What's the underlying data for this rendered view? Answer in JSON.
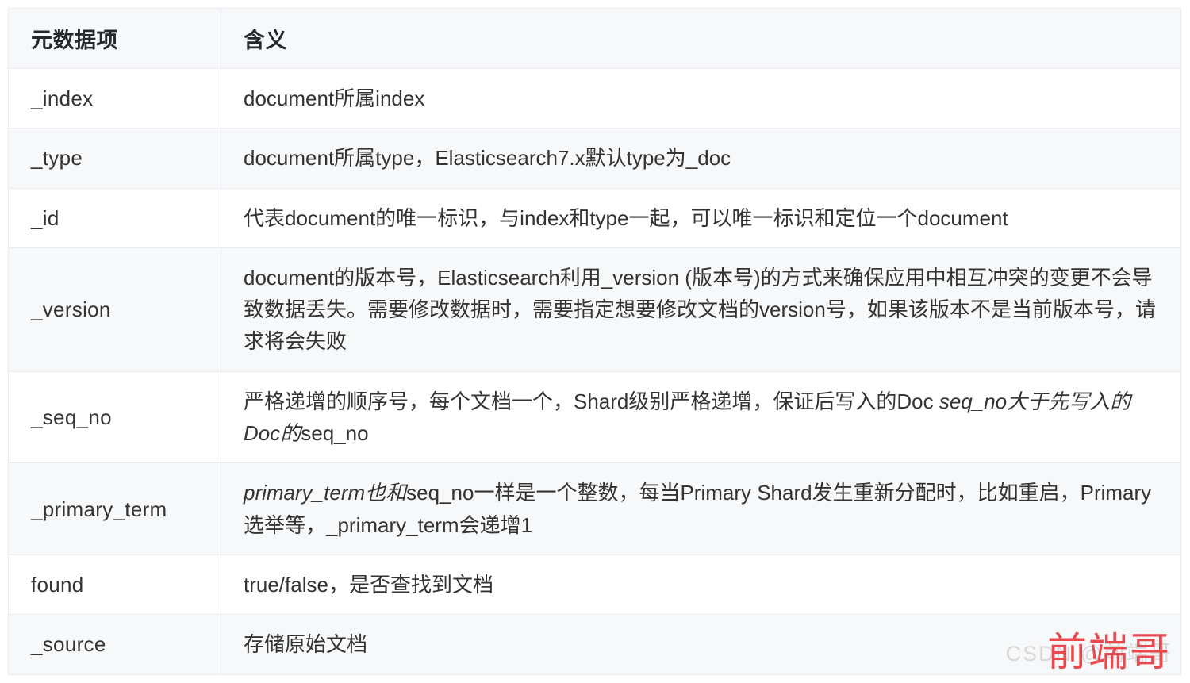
{
  "table": {
    "headers": [
      "元数据项",
      "含义"
    ],
    "rows": [
      {
        "key": "_index",
        "value_segments": [
          {
            "text": "document所属index",
            "italic": false
          }
        ]
      },
      {
        "key": "_type",
        "value_segments": [
          {
            "text": "document所属type，Elasticsearch7.x默认type为_doc",
            "italic": false
          }
        ]
      },
      {
        "key": "_id",
        "value_segments": [
          {
            "text": "代表document的唯一标识，与index和type一起，可以唯一标识和定位一个document",
            "italic": false
          }
        ]
      },
      {
        "key": "_version",
        "value_segments": [
          {
            "text": "document的版本号，Elasticsearch利用_version (版本号)的方式来确保应用中相互冲突的变更不会导致数据丢失。需要修改数据时，需要指定想要修改文档的version号，如果该版本不是当前版本号，请求将会失败",
            "italic": false
          }
        ]
      },
      {
        "key": "_seq_no",
        "value_segments": [
          {
            "text": "严格递增的顺序号，每个文档一个，Shard级别严格递增，保证后写入的Doc ",
            "italic": false
          },
          {
            "text": "seq_no大于先写入的Doc的",
            "italic": true
          },
          {
            "text": "seq_no",
            "italic": false
          }
        ]
      },
      {
        "key": "_primary_term",
        "value_segments": [
          {
            "text": "primary_term也和",
            "italic": true
          },
          {
            "text": "seq_no一样是一个整数，每当Primary Shard发生重新分配时，比如重启，Primary选举等，_primary_term会递增1",
            "italic": false
          }
        ]
      },
      {
        "key": "found",
        "value_segments": [
          {
            "text": "true/false，是否查找到文档",
            "italic": false
          }
        ]
      },
      {
        "key": "_source",
        "value_segments": [
          {
            "text": "存储原始文档",
            "italic": false
          }
        ]
      }
    ]
  },
  "watermark": {
    "brand": "前端哥",
    "site": "CSDN @前端哥",
    "brand_color": "#e8494f",
    "site_color": "#d8d8d8"
  },
  "theme": {
    "header_bg": "#f6f8fa",
    "row_alt_bg": "#f6f8fa",
    "row_bg": "#ffffff",
    "border": "#eaecef",
    "text": "#333333",
    "header_text": "#24292e"
  }
}
